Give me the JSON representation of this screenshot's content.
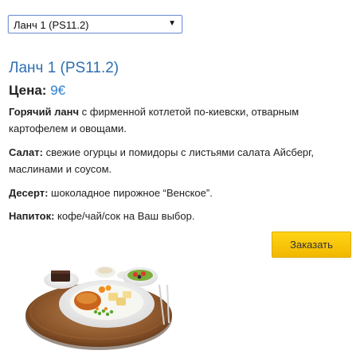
{
  "dropdown": {
    "selected": "Ланч 1 (PS11.2)"
  },
  "product": {
    "title": "Ланч 1 (PS11.2)",
    "price_label": "Цена:",
    "price_value": "9€",
    "hot_label": "Горячий ланч",
    "hot_text": " с фирменной котлетой по-киевски, отварным картофелем и овощами.",
    "salad_label": "Салат:",
    "salad_text": " свежие огурцы и помидоры с листьями салата Айсберг, маслинами и соусом.",
    "dessert_label": "Десерт:",
    "dessert_text": " шоколадное пирожное “Венское”.",
    "drink_label": "Напиток:",
    "drink_text": " кофе/чай/сок на Ваш выбор."
  },
  "actions": {
    "order_label": "Заказать"
  },
  "icons": {
    "dropdown_arrow": "dropdown-arrow-icon"
  },
  "colors": {
    "title": "#2f6fb0",
    "price": "#2a7fd1",
    "button": "#f7c600"
  }
}
